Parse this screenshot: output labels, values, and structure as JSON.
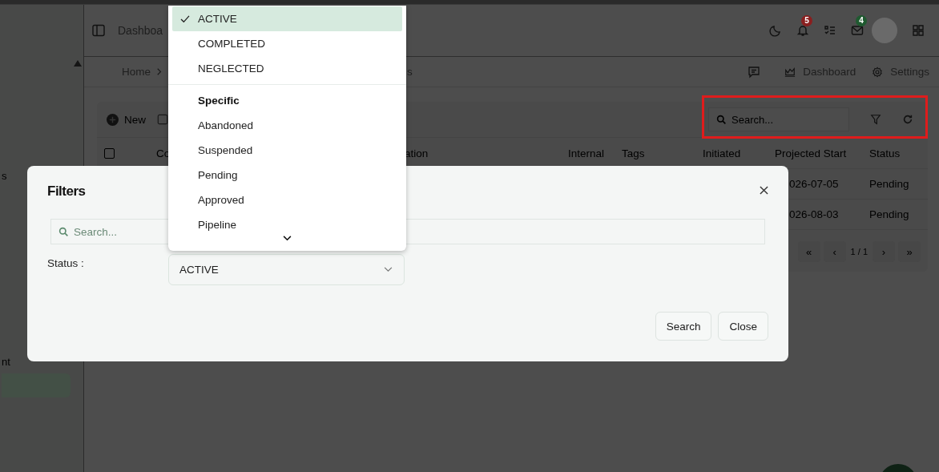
{
  "sidebar": {
    "items": [
      {
        "label": "s",
        "selected": false
      },
      {
        "label": "nt",
        "selected": false
      },
      {
        "selected": true
      }
    ]
  },
  "topbar": {
    "title": "Dashboa",
    "notifications_badge": "5",
    "messages_badge": "4"
  },
  "breadcrumb": {
    "items": [
      "Home",
      "s"
    ]
  },
  "page_actions": [
    {
      "kind": "chart",
      "label": "Dashboard"
    },
    {
      "kind": "gear",
      "label": "Settings"
    }
  ],
  "toolbar": {
    "new_label": "New",
    "search_placeholder": "Search..."
  },
  "table": {
    "select_all_checked": false,
    "columns": [
      "Co",
      "ation",
      "Internal",
      "Tags",
      "Initiated",
      "Projected Start",
      "Status"
    ],
    "rows": [
      {
        "projected_start": "026-07-05",
        "status": "Pending"
      },
      {
        "projected_start": "026-08-03",
        "status": "Pending"
      }
    ],
    "pagination": {
      "first": "«",
      "prev": "‹",
      "page": "1 / 1",
      "next": "›",
      "last": "»"
    }
  },
  "filters_dialog": {
    "title": "Filters",
    "search_placeholder": "Search...",
    "status_label": "Status :",
    "status_value": "ACTIVE",
    "buttons": [
      "Search",
      "Close"
    ]
  },
  "status_menu": {
    "groups": [
      {
        "options": [
          {
            "label": "ACTIVE",
            "selected": true
          },
          {
            "label": "COMPLETED",
            "selected": false
          },
          {
            "label": "NEGLECTED",
            "selected": false
          }
        ]
      },
      {
        "heading": "Specific",
        "options": [
          {
            "label": "Abandoned",
            "selected": false
          },
          {
            "label": "Suspended",
            "selected": false
          },
          {
            "label": "Pending",
            "selected": false
          },
          {
            "label": "Approved",
            "selected": false
          },
          {
            "label": "Pipeline",
            "selected": false
          }
        ]
      }
    ]
  }
}
